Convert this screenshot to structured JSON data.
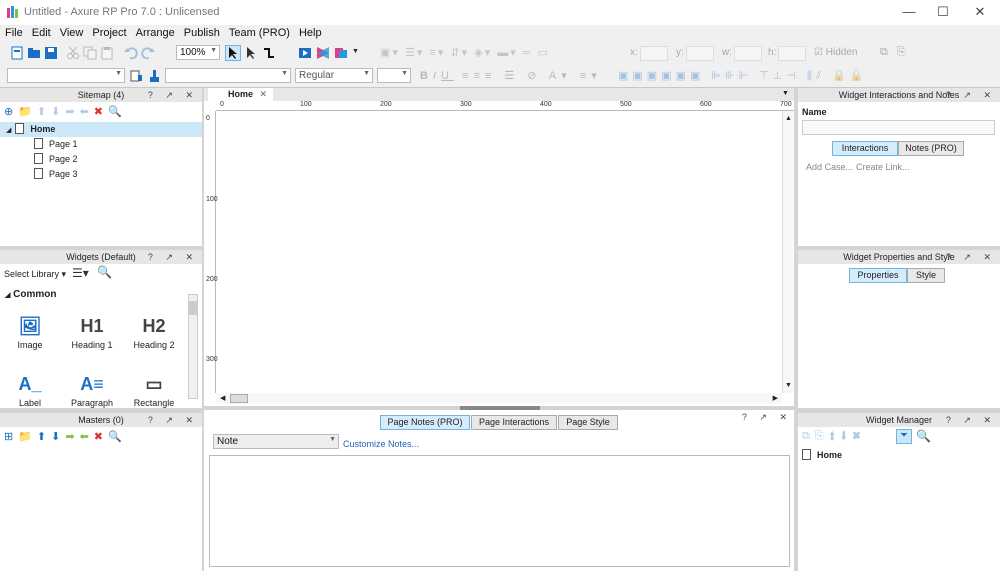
{
  "window": {
    "title": "Untitled - Axure RP Pro 7.0 : Unlicensed",
    "minimize": "—",
    "maximize": "☐",
    "close": "✕"
  },
  "menu": [
    "File",
    "Edit",
    "View",
    "Project",
    "Arrange",
    "Publish",
    "Team (PRO)",
    "Help"
  ],
  "toolbar": {
    "zoom": "100%",
    "font_style": "Regular",
    "x_label": "x:",
    "y_label": "y:",
    "w_label": "w:",
    "h_label": "h:",
    "hidden_label": "Hidden"
  },
  "sitemap": {
    "title": "Sitemap (4)",
    "home": "Home",
    "pages": [
      "Page 1",
      "Page 2",
      "Page 3"
    ]
  },
  "widgets": {
    "title": "Widgets (Default)",
    "select_library": "Select Library",
    "category": "Common",
    "items": [
      {
        "label": "Image",
        "glyph": "🖼"
      },
      {
        "label": "Heading 1",
        "glyph": "H1"
      },
      {
        "label": "Heading 2",
        "glyph": "H2"
      },
      {
        "label": "Label",
        "glyph": "A_"
      },
      {
        "label": "Paragraph",
        "glyph": "A≡"
      },
      {
        "label": "Rectangle",
        "glyph": "▭"
      }
    ]
  },
  "masters": {
    "title": "Masters (0)"
  },
  "canvas": {
    "tab": "Home",
    "ruler_h": [
      "0",
      "100",
      "200",
      "300",
      "400",
      "500",
      "600",
      "700"
    ],
    "ruler_v": [
      "0",
      "100",
      "200",
      "300"
    ]
  },
  "bottom": {
    "tabs": [
      "Page Notes (PRO)",
      "Page Interactions",
      "Page Style"
    ],
    "note_select": "Note",
    "customize": "Customize Notes..."
  },
  "interactions": {
    "title": "Widget Interactions and Notes",
    "name_label": "Name",
    "tab_interactions": "Interactions",
    "tab_notes": "Notes (PRO)",
    "add_case": "Add Case...",
    "create_link": "Create Link..."
  },
  "properties": {
    "title": "Widget Properties and Style",
    "tab_properties": "Properties",
    "tab_style": "Style"
  },
  "manager": {
    "title": "Widget Manager",
    "home": "Home"
  },
  "panel_buttons": "? ↗ ✕",
  "colors": {
    "accent": "#6fb5e0",
    "selection": "#cce8f8",
    "link": "#2266b8"
  }
}
